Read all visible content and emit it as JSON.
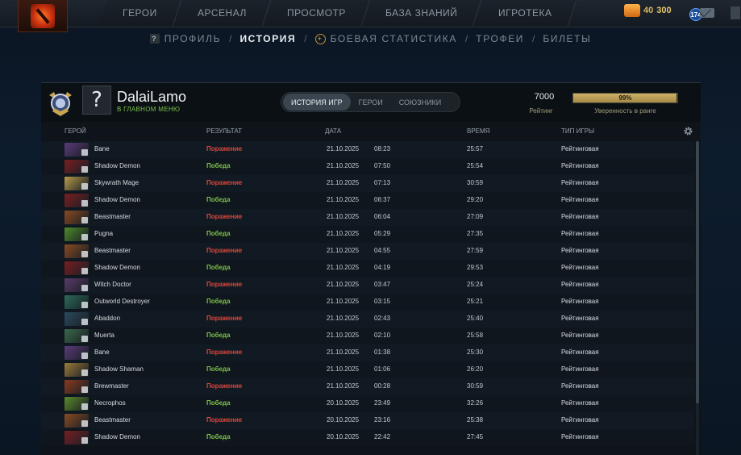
{
  "topnav": {
    "tabs": [
      "ГЕРОИ",
      "АРСЕНАЛ",
      "ПРОСМОТР",
      "БАЗА ЗНАНИЙ",
      "ИГРОТЕКА"
    ],
    "coins": "40",
    "shards": "300",
    "level": "174"
  },
  "subnav": {
    "profile": "ПРОФИЛЬ",
    "history": "ИСТОРИЯ",
    "stats": "БОЕВАЯ СТАТИСТИКА",
    "trophies": "ТРОФЕИ",
    "tickets": "БИЛЕТЫ",
    "separator": "/"
  },
  "profile": {
    "avatar_glyph": "?",
    "name": "DalaiLamo",
    "status": "В ГЛАВНОМ МЕНЮ",
    "tabs": [
      "ИСТОРИЯ ИГР",
      "ГЕРОИ",
      "СОЮЗНИКИ"
    ],
    "rating": "7000",
    "rating_label": "Рейтинг",
    "confidence": "99%",
    "confidence_fraction": 0.99,
    "confidence_label": "Уверенность в ранге"
  },
  "table": {
    "headers": {
      "hero": "ГЕРОЙ",
      "result": "РЕЗУЛЬТАТ",
      "date": "ДАТА",
      "duration": "ВРЕМЯ",
      "type": "ТИП ИГРЫ"
    },
    "rows": [
      {
        "hero": "Bane",
        "result": "Поражение",
        "win": false,
        "date": "21.10.2025",
        "time": "08:23",
        "duration": "25:57",
        "type": "Рейтинговая",
        "color": "#5a3a7a"
      },
      {
        "hero": "Shadow Demon",
        "result": "Победа",
        "win": true,
        "date": "21.10.2025",
        "time": "07:50",
        "duration": "25:54",
        "type": "Рейтинговая",
        "color": "#7a1e22"
      },
      {
        "hero": "Skywrath Mage",
        "result": "Поражение",
        "win": false,
        "date": "21.10.2025",
        "time": "07:13",
        "duration": "30:59",
        "type": "Рейтинговая",
        "color": "#b89a4a"
      },
      {
        "hero": "Shadow Demon",
        "result": "Победа",
        "win": true,
        "date": "21.10.2025",
        "time": "06:37",
        "duration": "29:20",
        "type": "Рейтинговая",
        "color": "#7a1e22"
      },
      {
        "hero": "Beastmaster",
        "result": "Поражение",
        "win": false,
        "date": "21.10.2025",
        "time": "06:04",
        "duration": "27:09",
        "type": "Рейтинговая",
        "color": "#8a4a22"
      },
      {
        "hero": "Pugna",
        "result": "Победа",
        "win": true,
        "date": "21.10.2025",
        "time": "05:29",
        "duration": "27:35",
        "type": "Рейтинговая",
        "color": "#4e8a2a"
      },
      {
        "hero": "Beastmaster",
        "result": "Поражение",
        "win": false,
        "date": "21.10.2025",
        "time": "04:55",
        "duration": "27:59",
        "type": "Рейтинговая",
        "color": "#8a4a22"
      },
      {
        "hero": "Shadow Demon",
        "result": "Победа",
        "win": true,
        "date": "21.10.2025",
        "time": "04:19",
        "duration": "29:53",
        "type": "Рейтинговая",
        "color": "#7a1e22"
      },
      {
        "hero": "Witch Doctor",
        "result": "Поражение",
        "win": false,
        "date": "21.10.2025",
        "time": "03:47",
        "duration": "25:24",
        "type": "Рейтинговая",
        "color": "#5a3a6a"
      },
      {
        "hero": "Outworld Destroyer",
        "result": "Победа",
        "win": true,
        "date": "21.10.2025",
        "time": "03:15",
        "duration": "25:21",
        "type": "Рейтинговая",
        "color": "#2a6a5a"
      },
      {
        "hero": "Abaddon",
        "result": "Поражение",
        "win": false,
        "date": "21.10.2025",
        "time": "02:43",
        "duration": "25:40",
        "type": "Рейтинговая",
        "color": "#2a4a5e"
      },
      {
        "hero": "Muerta",
        "result": "Победа",
        "win": true,
        "date": "21.10.2025",
        "time": "02:10",
        "duration": "25:58",
        "type": "Рейтинговая",
        "color": "#3a6a4a"
      },
      {
        "hero": "Bane",
        "result": "Поражение",
        "win": false,
        "date": "21.10.2025",
        "time": "01:38",
        "duration": "25:30",
        "type": "Рейтинговая",
        "color": "#5a3a7a"
      },
      {
        "hero": "Shadow Shaman",
        "result": "Победа",
        "win": true,
        "date": "21.10.2025",
        "time": "01:06",
        "duration": "26:20",
        "type": "Рейтинговая",
        "color": "#9a7a3a"
      },
      {
        "hero": "Brewmaster",
        "result": "Поражение",
        "win": false,
        "date": "21.10.2025",
        "time": "00:28",
        "duration": "30:59",
        "type": "Рейтинговая",
        "color": "#8a3a1e"
      },
      {
        "hero": "Necrophos",
        "result": "Победа",
        "win": true,
        "date": "20.10.2025",
        "time": "23:49",
        "duration": "32:26",
        "type": "Рейтинговая",
        "color": "#5a8a2a"
      },
      {
        "hero": "Beastmaster",
        "result": "Поражение",
        "win": false,
        "date": "20.10.2025",
        "time": "23:16",
        "duration": "25:38",
        "type": "Рейтинговая",
        "color": "#8a4a22"
      },
      {
        "hero": "Shadow Demon",
        "result": "Победа",
        "win": true,
        "date": "20.10.2025",
        "time": "22:42",
        "duration": "27:45",
        "type": "Рейтинговая",
        "color": "#7a1e22"
      }
    ]
  }
}
